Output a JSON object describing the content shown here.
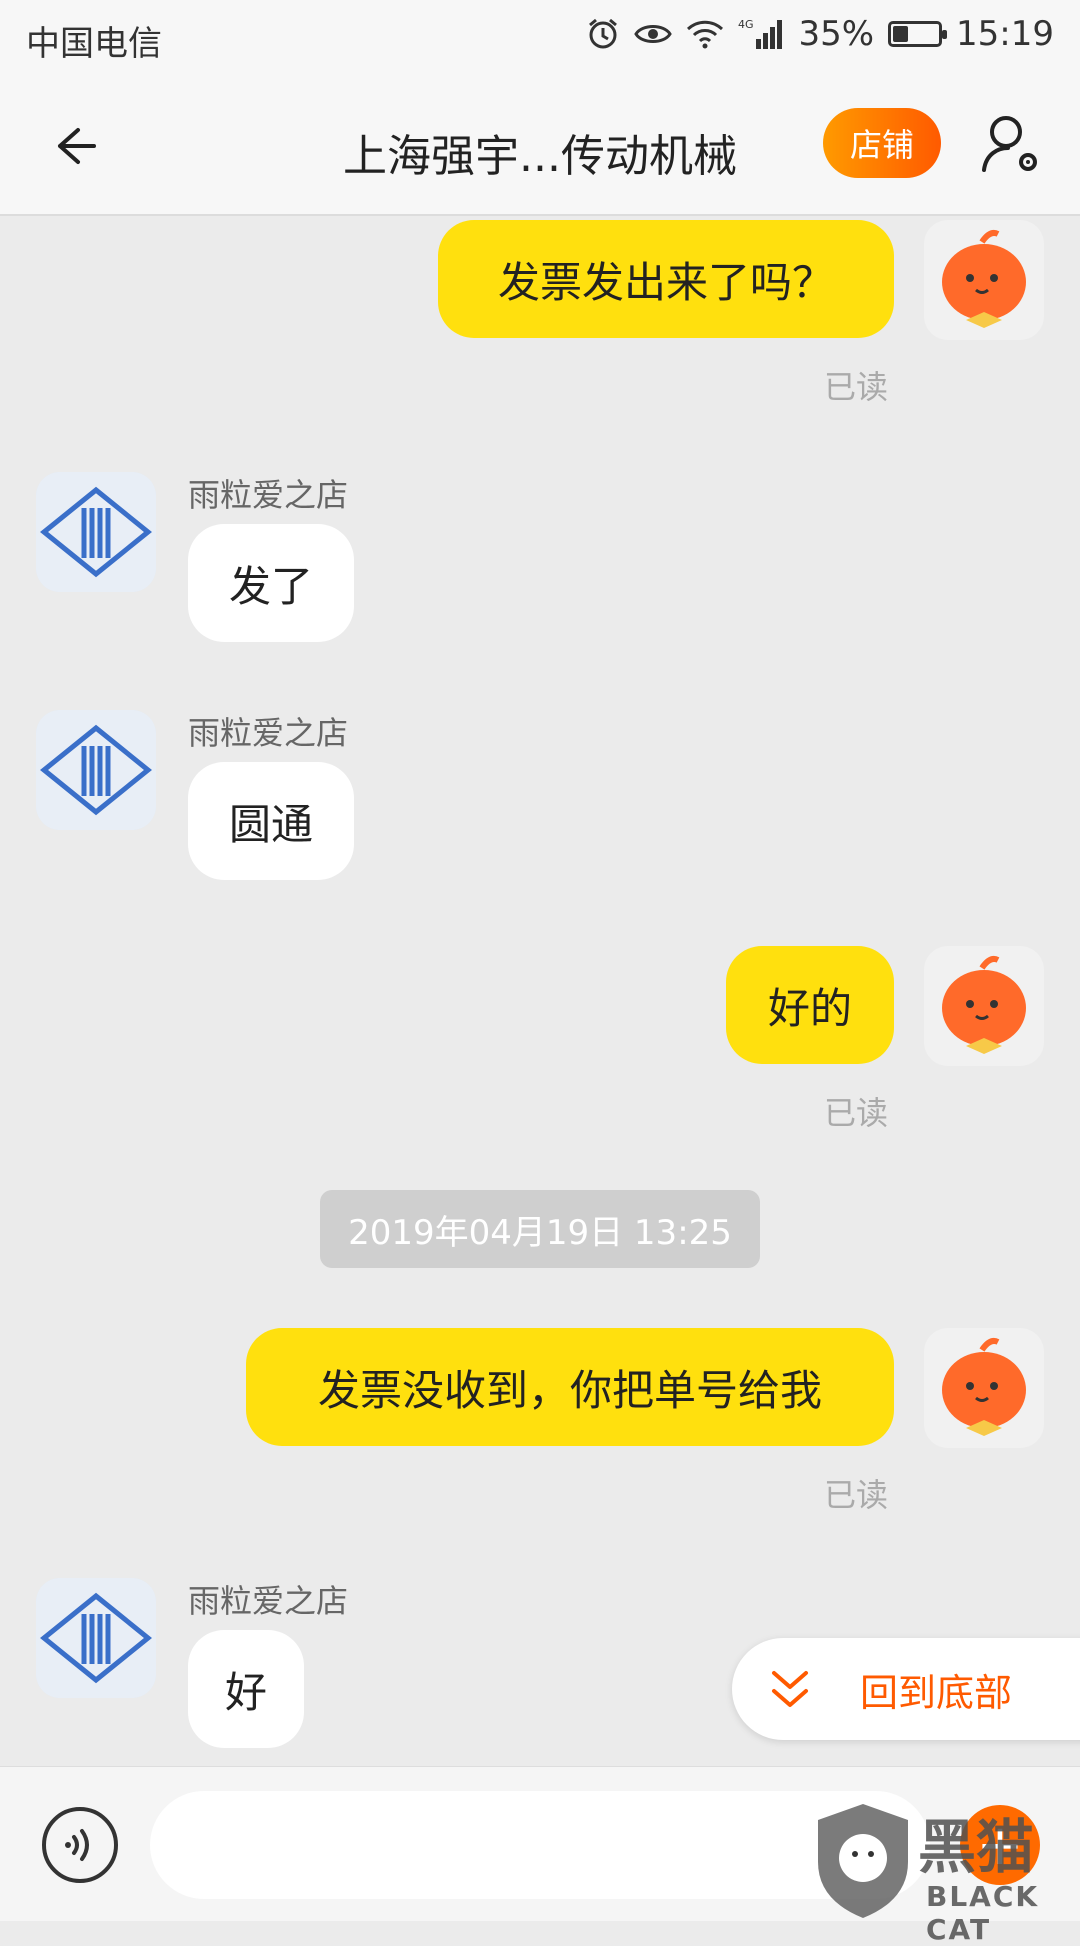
{
  "status_bar": {
    "carrier": "中国电信",
    "network": "4G",
    "battery_percent": "35%",
    "battery_level": 0.35,
    "time": "15:19"
  },
  "nav": {
    "title": "上海强宇...传动机械",
    "store_label": "店铺"
  },
  "messages": [
    {
      "from": "me",
      "text": "发票发出来了吗？",
      "status": "已读"
    },
    {
      "from": "shop",
      "sender": "雨粒爱之店",
      "text": "发了"
    },
    {
      "from": "shop",
      "sender": "雨粒爱之店",
      "text": "圆通"
    },
    {
      "from": "me",
      "text": "好的",
      "status": "已读"
    },
    {
      "type": "timestamp",
      "text": "2019年04月19日 13:25"
    },
    {
      "from": "me",
      "text": "发票没收到，你把单号给我",
      "status": "已读"
    },
    {
      "from": "shop",
      "sender": "雨粒爱之店",
      "text": "好"
    }
  ],
  "back_to_bottom_label": "回到底部",
  "input": {
    "value": "",
    "placeholder": ""
  },
  "watermark": {
    "line1": "黑猫",
    "line2": "BLACK CAT"
  },
  "colors": {
    "my_bubble": "#ffe00e",
    "accent": "#ff5a00",
    "background": "#ebebeb"
  }
}
